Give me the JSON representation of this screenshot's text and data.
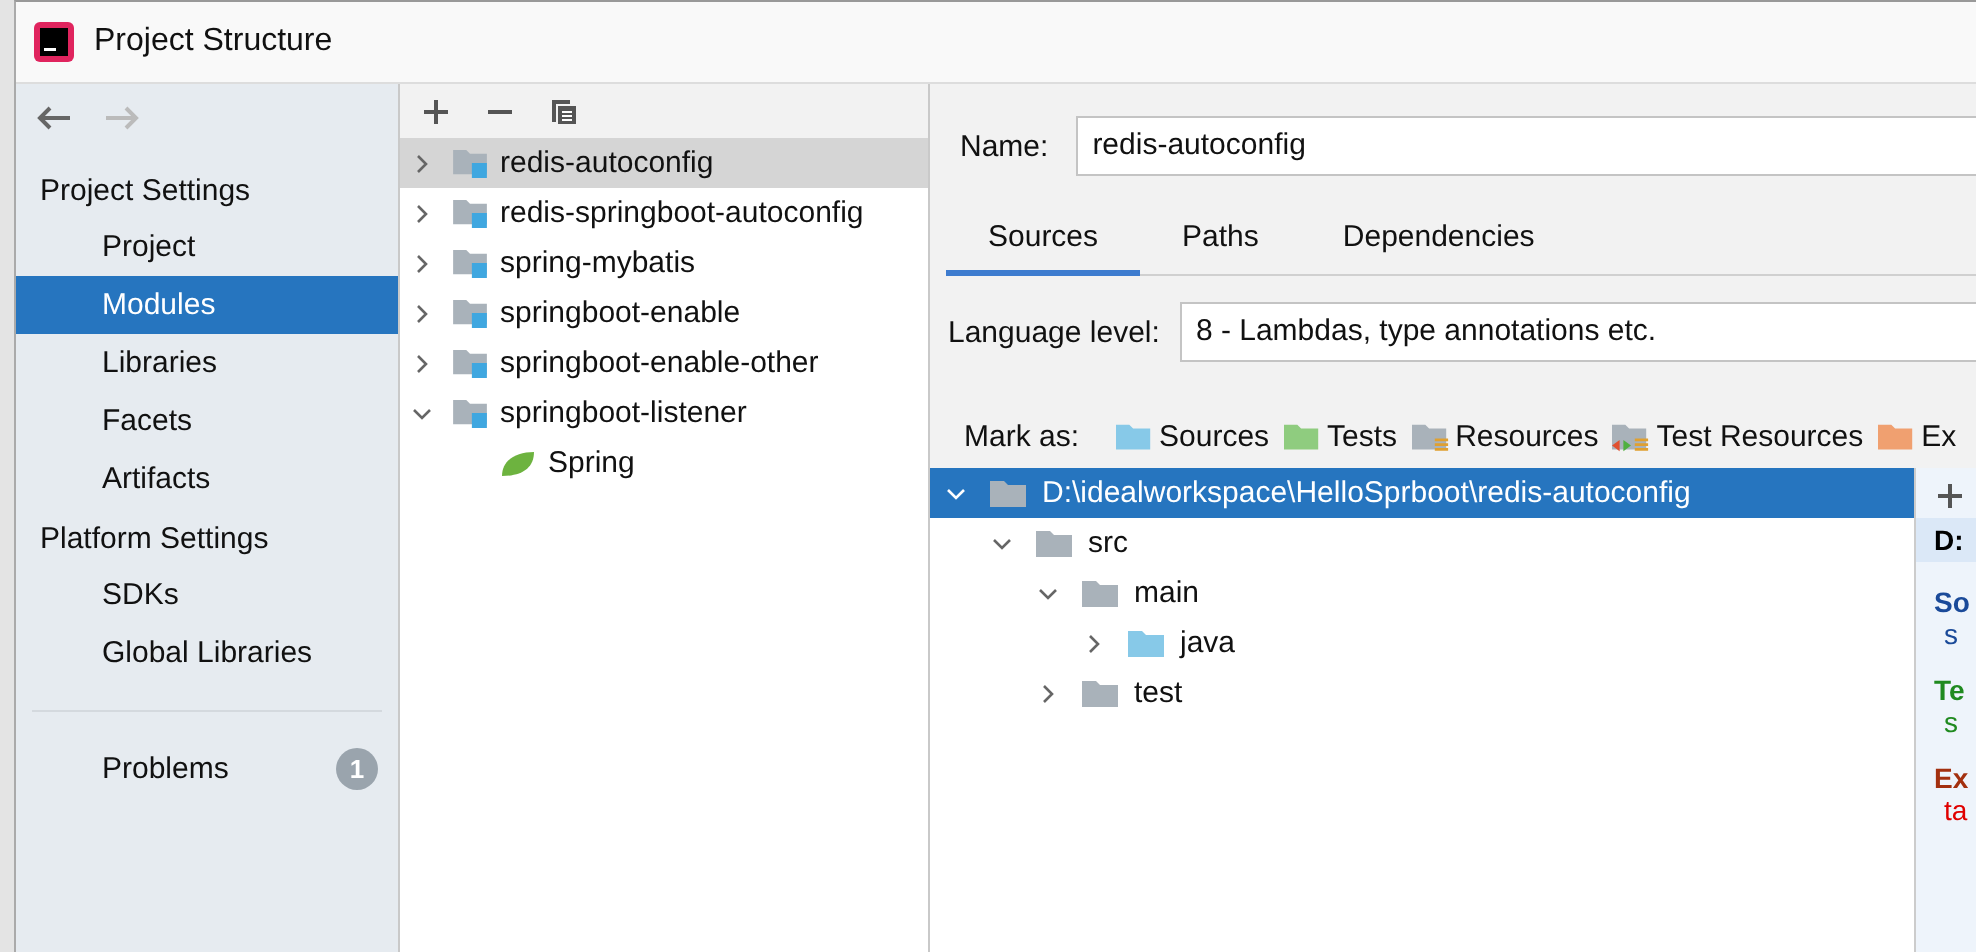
{
  "window": {
    "title": "Project Structure"
  },
  "sidebar": {
    "sections": [
      {
        "heading": "Project Settings",
        "items": [
          {
            "label": "Project",
            "selected": false
          },
          {
            "label": "Modules",
            "selected": true
          },
          {
            "label": "Libraries",
            "selected": false
          },
          {
            "label": "Facets",
            "selected": false
          },
          {
            "label": "Artifacts",
            "selected": false
          }
        ]
      },
      {
        "heading": "Platform Settings",
        "items": [
          {
            "label": "SDKs",
            "selected": false
          },
          {
            "label": "Global Libraries",
            "selected": false
          }
        ]
      }
    ],
    "problems": {
      "label": "Problems",
      "count": "1"
    }
  },
  "modules": [
    {
      "label": "redis-autoconfig",
      "kind": "module",
      "selected": true,
      "expanded": false
    },
    {
      "label": "redis-springboot-autoconfig",
      "kind": "module",
      "selected": false,
      "expanded": false
    },
    {
      "label": "spring-mybatis",
      "kind": "module",
      "selected": false,
      "expanded": false
    },
    {
      "label": "springboot-enable",
      "kind": "module",
      "selected": false,
      "expanded": false
    },
    {
      "label": "springboot-enable-other",
      "kind": "module",
      "selected": false,
      "expanded": false
    },
    {
      "label": "springboot-listener",
      "kind": "module",
      "selected": false,
      "expanded": true,
      "children": [
        {
          "label": "Spring",
          "kind": "facet",
          "selected": false
        }
      ]
    }
  ],
  "detail": {
    "name_label": "Name:",
    "name_value": "redis-autoconfig",
    "tabs": [
      {
        "label": "Sources",
        "selected": true
      },
      {
        "label": "Paths",
        "selected": false
      },
      {
        "label": "Dependencies",
        "selected": false
      }
    ],
    "language_label": "Language level:",
    "language_value": "8 - Lambdas, type annotations etc.",
    "mark_as_label": "Mark as:",
    "mark_as": [
      {
        "label": "Sources",
        "kind": "folder",
        "color": "#87c9e8"
      },
      {
        "label": "Tests",
        "kind": "folder",
        "color": "#8fcc7f"
      },
      {
        "label": "Resources",
        "kind": "resources",
        "color": "#a9b2ba"
      },
      {
        "label": "Test Resources",
        "kind": "test-resources",
        "color": "#a9b2ba"
      },
      {
        "label": "Ex",
        "kind": "folder",
        "color": "#f0a070"
      }
    ],
    "tree": [
      {
        "label": "D:\\idealworkspace\\HelloSprboot\\redis-autoconfig",
        "color": "#a9b2ba",
        "selected": true,
        "expanded": true,
        "children": [
          {
            "label": "src",
            "color": "#a9b2ba",
            "selected": false,
            "expanded": true,
            "children": [
              {
                "label": "main",
                "color": "#a9b2ba",
                "selected": false,
                "expanded": true,
                "children": [
                  {
                    "label": "java",
                    "color": "#87c9e8",
                    "selected": false,
                    "expanded": false
                  }
                ]
              },
              {
                "label": "test",
                "color": "#a9b2ba",
                "selected": false,
                "expanded": false
              }
            ]
          }
        ]
      }
    ],
    "root_panel": {
      "entries": [
        {
          "text": "D:",
          "kind": "header",
          "color": "#000000"
        },
        {
          "text": "So",
          "kind": "heading",
          "color": "#1a4a99"
        },
        {
          "text": "s",
          "kind": "path",
          "color": "#1a4a99"
        },
        {
          "text": "Te",
          "kind": "heading",
          "color": "#1f8a1f"
        },
        {
          "text": "s",
          "kind": "path",
          "color": "#1f8a1f"
        },
        {
          "text": "Ex",
          "kind": "heading",
          "color": "#a3300f"
        },
        {
          "text": "ta",
          "kind": "path",
          "color": "#e00000"
        }
      ]
    }
  }
}
